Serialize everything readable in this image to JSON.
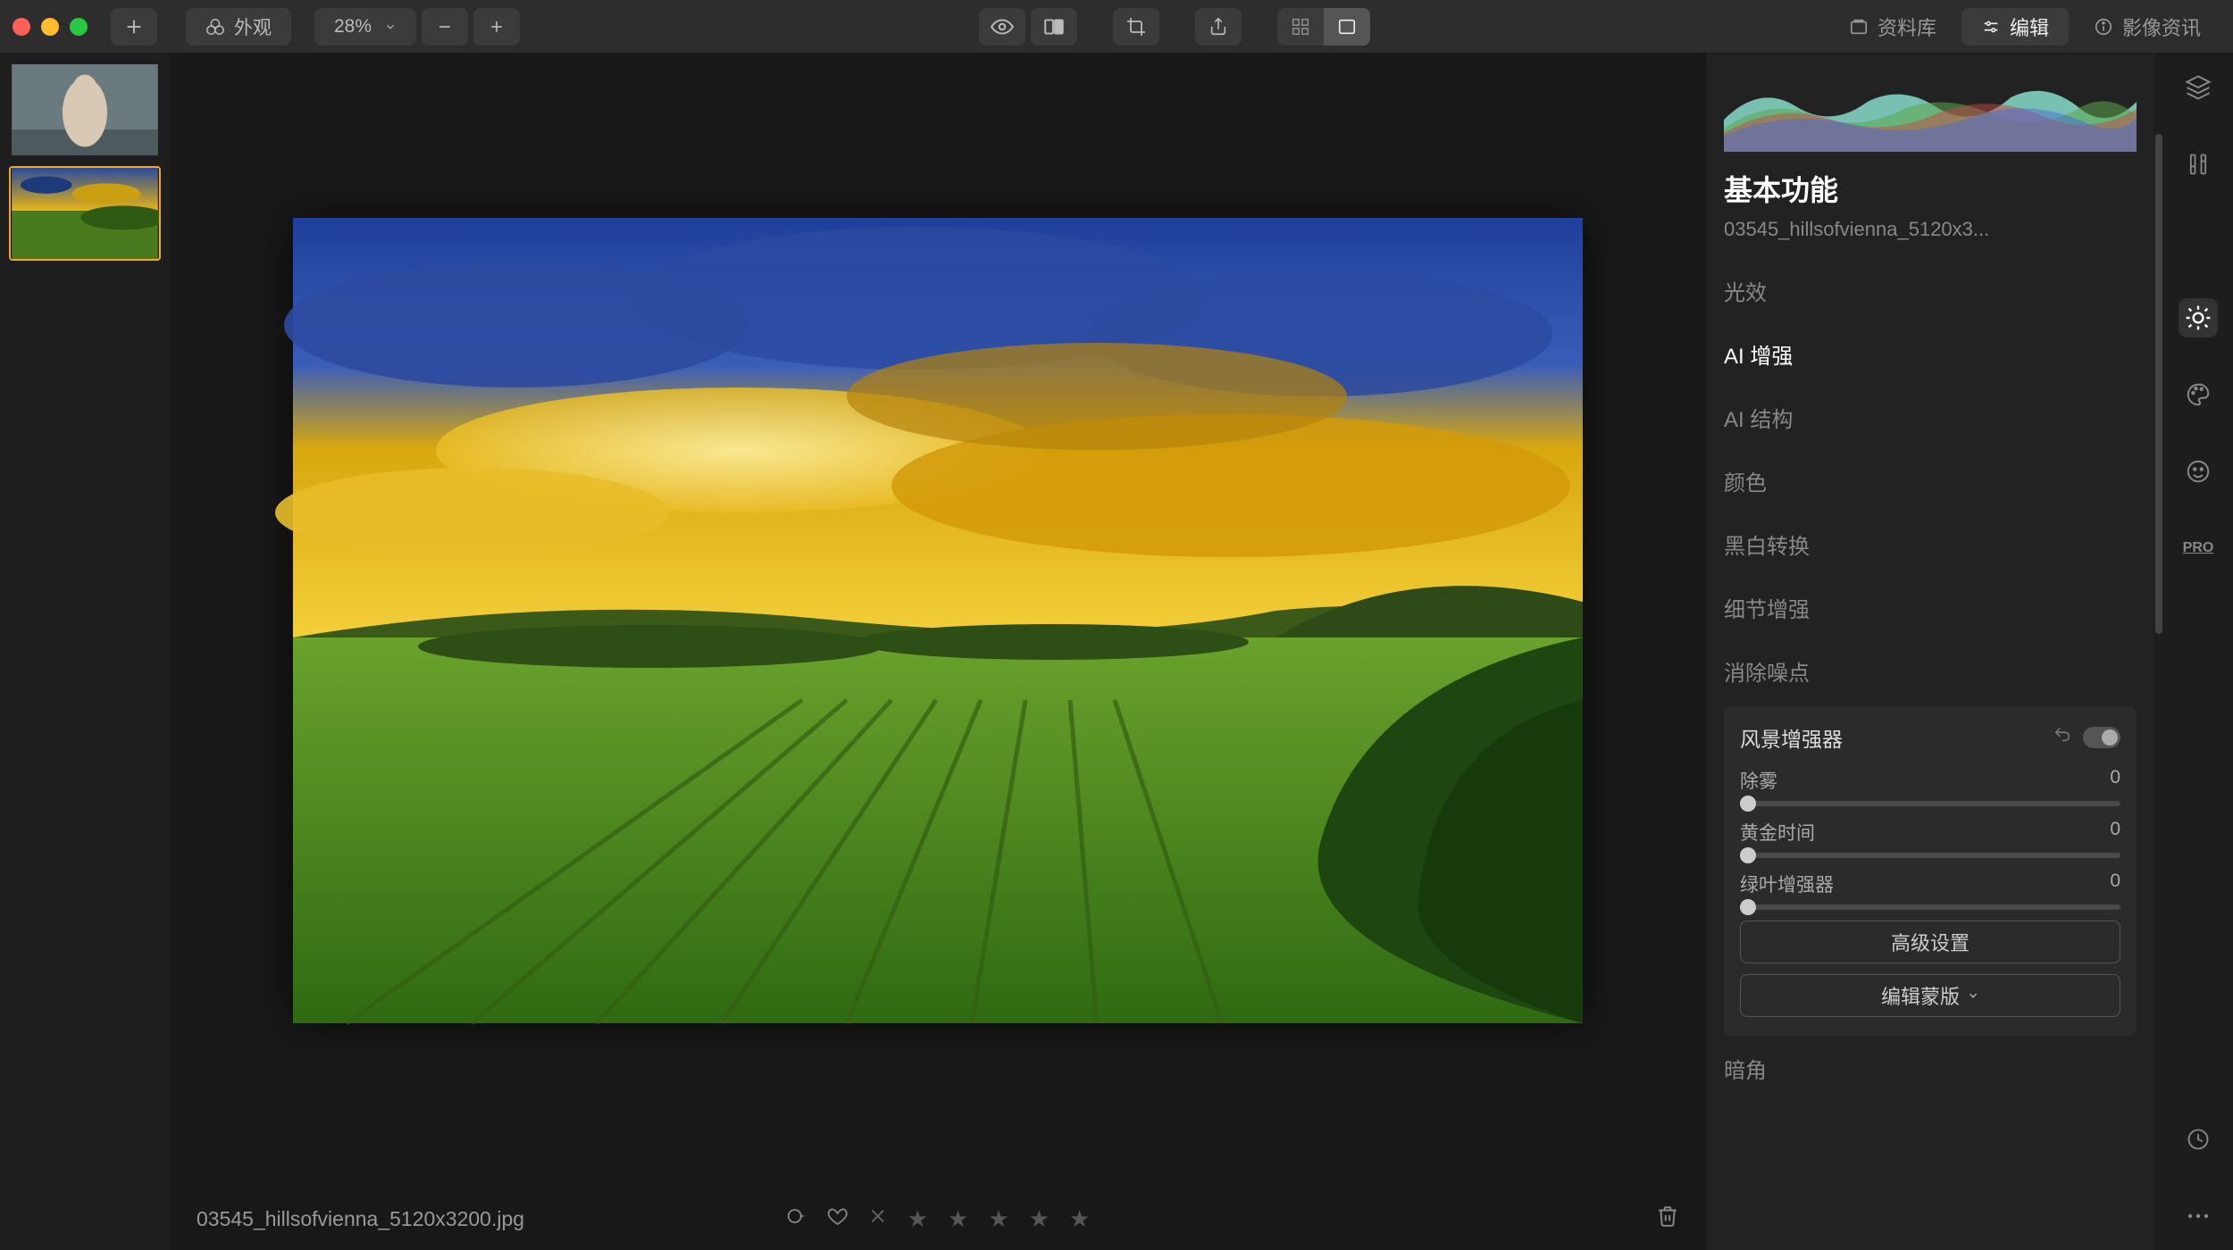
{
  "toolbar": {
    "appearance_label": "外观",
    "zoom_label": "28%",
    "tabs": {
      "library": "资料库",
      "edit": "编辑",
      "info": "影像资讯"
    }
  },
  "canvas": {
    "filename": "03545_hillsofvienna_5120x3200.jpg"
  },
  "panel": {
    "title": "基本功能",
    "subtitle": "03545_hillsofvienna_5120x3...",
    "tools": [
      {
        "label": "光效"
      },
      {
        "label": "AI 增强"
      },
      {
        "label": "AI 结构"
      },
      {
        "label": "颜色"
      },
      {
        "label": "黑白转换"
      },
      {
        "label": "细节增强"
      },
      {
        "label": "消除噪点"
      }
    ],
    "active_tool_index": 1,
    "landscape": {
      "title": "风景增强器",
      "sliders": [
        {
          "label": "除雾",
          "value": "0"
        },
        {
          "label": "黄金时间",
          "value": "0"
        },
        {
          "label": "绿叶增强器",
          "value": "0"
        }
      ],
      "advanced_btn": "高级设置",
      "mask_btn": "编辑蒙版"
    },
    "below": "暗角"
  },
  "rail": {
    "pro_label": "PRO"
  }
}
